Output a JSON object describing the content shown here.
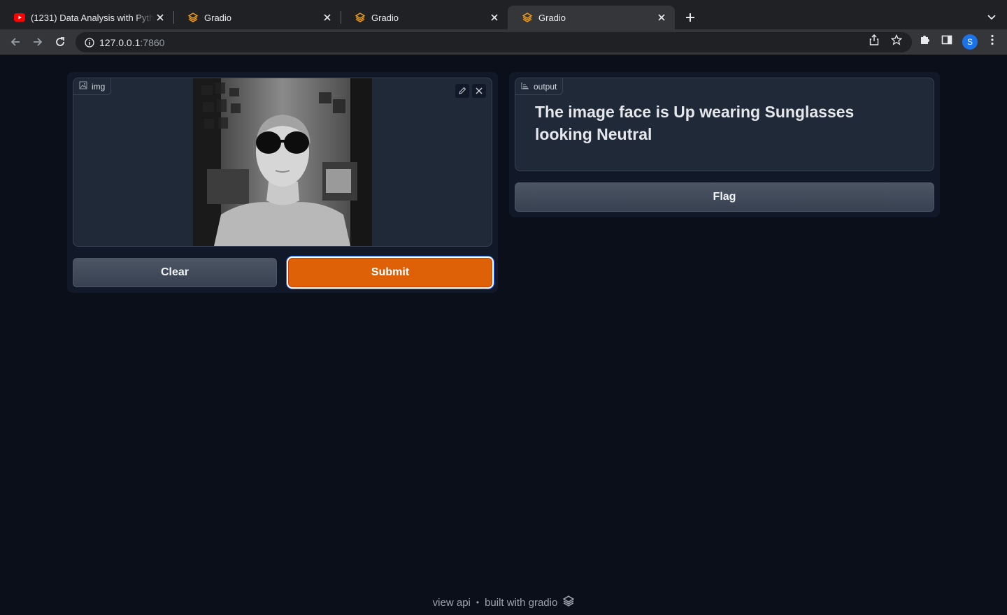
{
  "browser": {
    "tabs": [
      {
        "title": "(1231) Data Analysis with Pytho",
        "favicon": "youtube-icon",
        "active": false
      },
      {
        "title": "Gradio",
        "favicon": "gradio-icon",
        "active": false
      },
      {
        "title": "Gradio",
        "favicon": "gradio-icon",
        "active": false
      },
      {
        "title": "Gradio",
        "favicon": "gradio-icon",
        "active": true
      }
    ],
    "address": {
      "host": "127.0.0.1",
      "port": ":7860"
    },
    "profile_initial": "S"
  },
  "input_panel": {
    "image_label": "img",
    "clear_label": "Clear",
    "submit_label": "Submit"
  },
  "output_panel": {
    "output_label": "output",
    "output_text": "The image face is Up wearing Sunglasses looking Neutral",
    "flag_label": "Flag"
  },
  "footer": {
    "view_api": "view api",
    "separator": "•",
    "built_with": "built with gradio"
  },
  "colors": {
    "page_bg": "#0b0f19",
    "panel_bg": "#111827",
    "block_bg": "#1f2937",
    "primary": "#de6108",
    "focus_ring": "#2563eb"
  }
}
